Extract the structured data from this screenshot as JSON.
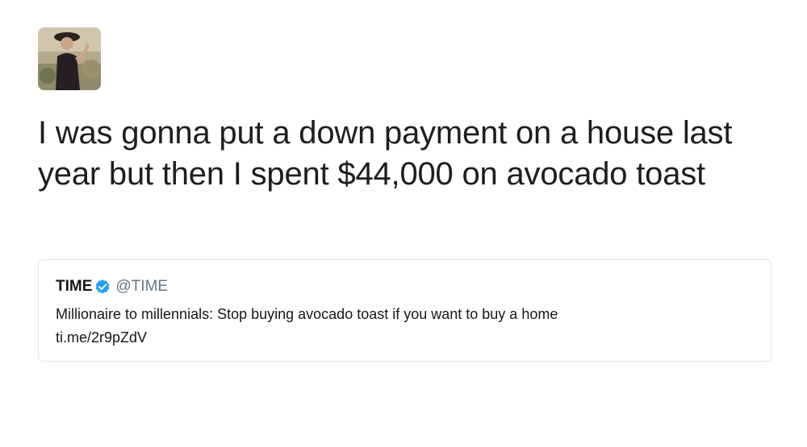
{
  "tweet": {
    "text": "I was gonna put a down payment on a house last year but then I spent $44,000 on avocado toast"
  },
  "quoted_tweet": {
    "name": "TIME",
    "handle": "@TIME",
    "verified_icon": "verified-badge",
    "text": "Millionaire to millennials: Stop buying avocado toast if you want to buy a home",
    "link": "ti.me/2r9pZdV"
  },
  "colors": {
    "verified_blue": "#1da1f2",
    "handle_gray": "#657786",
    "card_border": "#e1e8ed"
  }
}
